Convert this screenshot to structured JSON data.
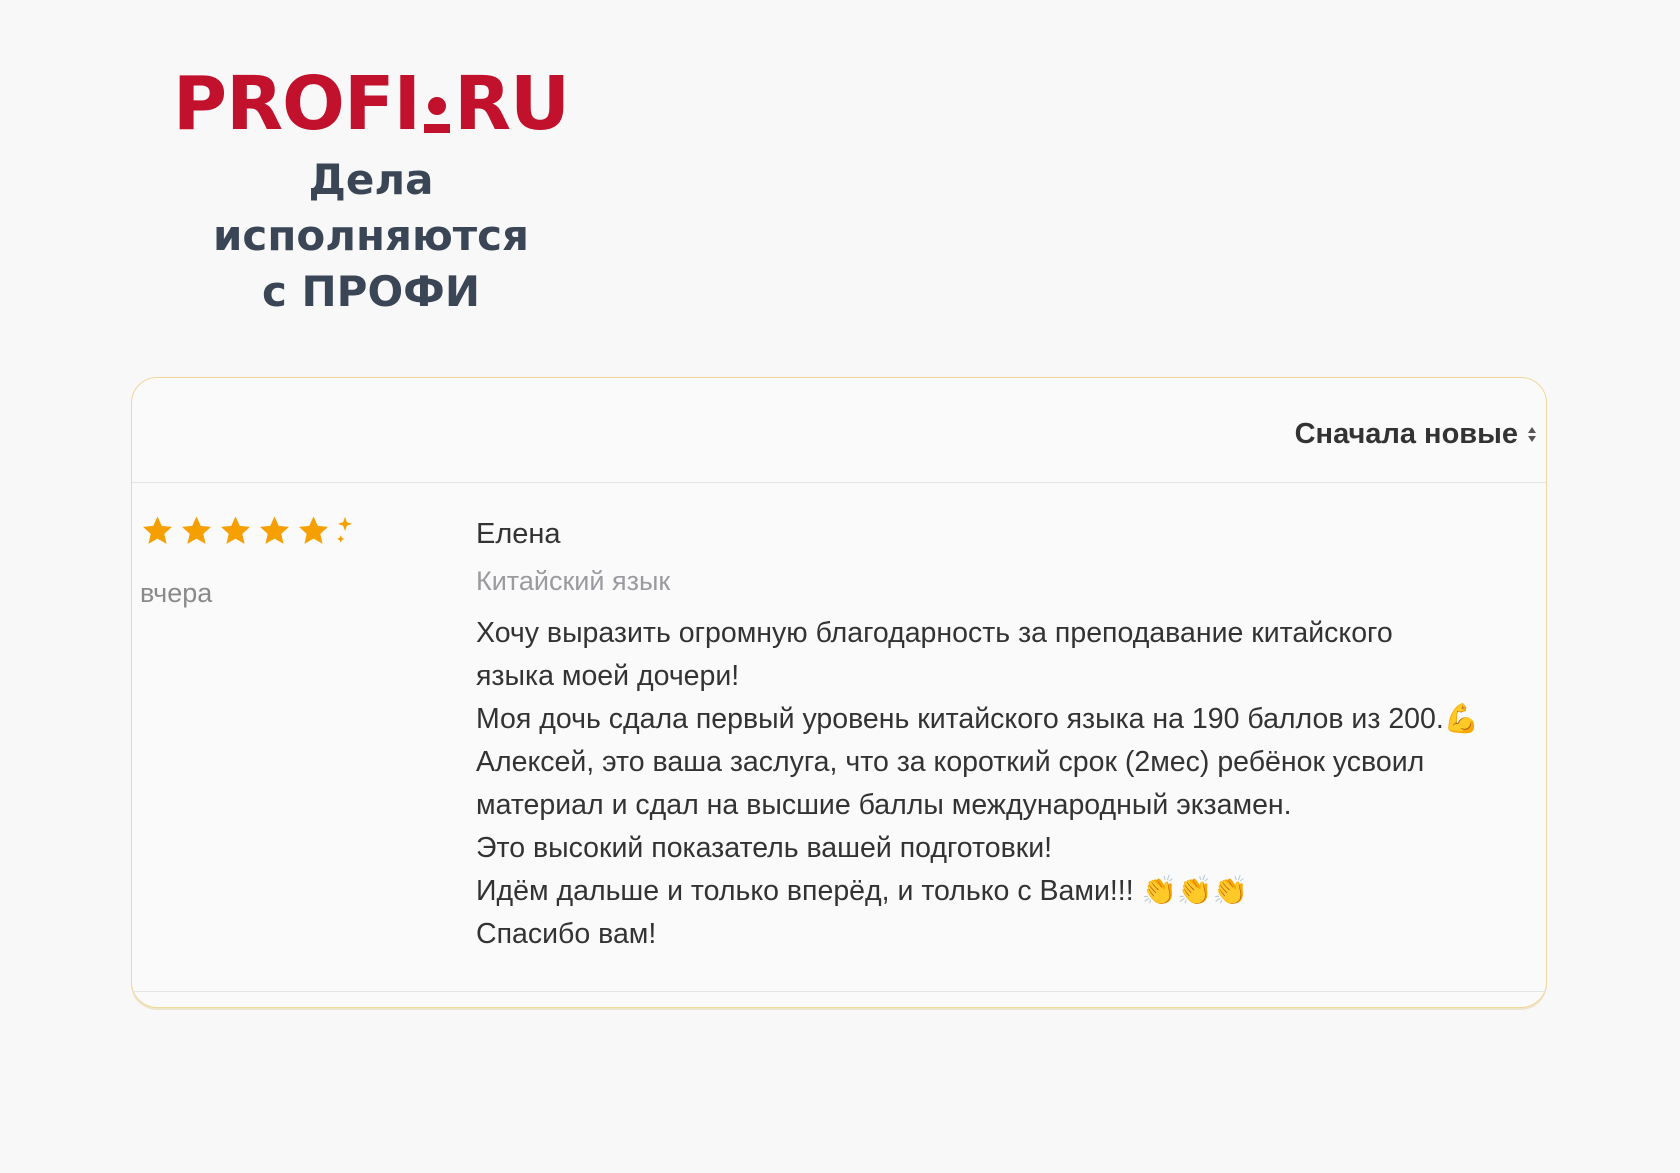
{
  "brand": {
    "logo_left": "PROFI",
    "logo_right": "RU",
    "tagline_line1": "Дела исполняются",
    "tagline_line2": "с ПРОФИ",
    "color": "#c2112d"
  },
  "reviews": {
    "sort_label": "Сначала новые",
    "sort_icon": "sort-updown-icon",
    "items": [
      {
        "rating": 5,
        "rating_max": 5,
        "rating_extra": "sparkle-icon",
        "date": "вчера",
        "author": "Елена",
        "subject": "Китайский язык",
        "lines": [
          "Хочу выразить огромную благодарность за преподавание китайского",
          "языка моей дочери!",
          "Моя дочь сдала первый уровень китайского языка на 190 баллов из 200.💪",
          "Алексей, это ваша заслуга, что за короткий срок (2мес) ребёнок усвоил",
          "материал и сдал на высшие баллы международный экзамен.",
          "Это высокий показатель вашей подготовки!",
          "Идём дальше и только вперёд, и только с Вами!!! 👏👏👏",
          "Спасибо вам!"
        ]
      }
    ],
    "star_color": "#f5a000"
  }
}
